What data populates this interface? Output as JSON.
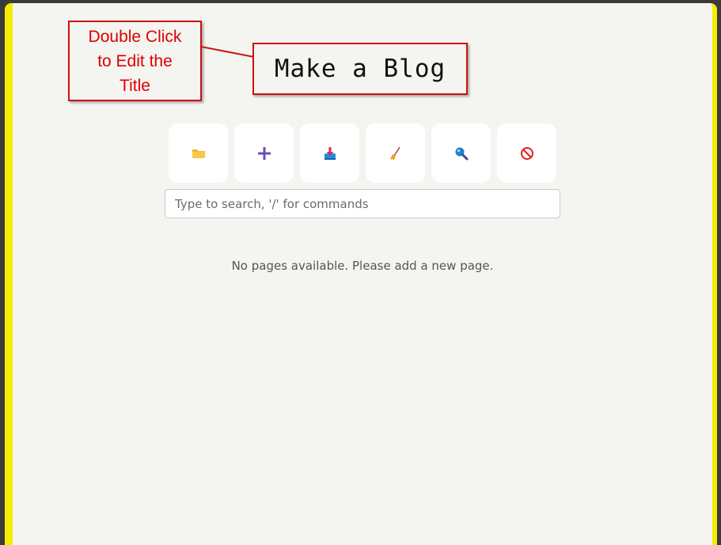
{
  "annotation": {
    "callout_lines": [
      "Double Click",
      "to Edit the",
      "Title"
    ],
    "color": "#dd0000"
  },
  "header": {
    "title": "Make a Blog"
  },
  "toolbar": {
    "buttons": [
      {
        "name": "open-folder",
        "icon": "folder-icon"
      },
      {
        "name": "add-page",
        "icon": "plus-icon"
      },
      {
        "name": "download",
        "icon": "download-icon"
      },
      {
        "name": "clear",
        "icon": "broom-icon"
      },
      {
        "name": "search",
        "icon": "magnifier-icon"
      },
      {
        "name": "cancel",
        "icon": "prohibited-icon"
      }
    ]
  },
  "search": {
    "placeholder": "Type to search, '/' for commands",
    "value": ""
  },
  "main": {
    "empty_message": "No pages available. Please add a new page."
  },
  "colors": {
    "frame_border": "#f5ec00",
    "background": "#f4f4f0",
    "callout": "#cc1111"
  }
}
